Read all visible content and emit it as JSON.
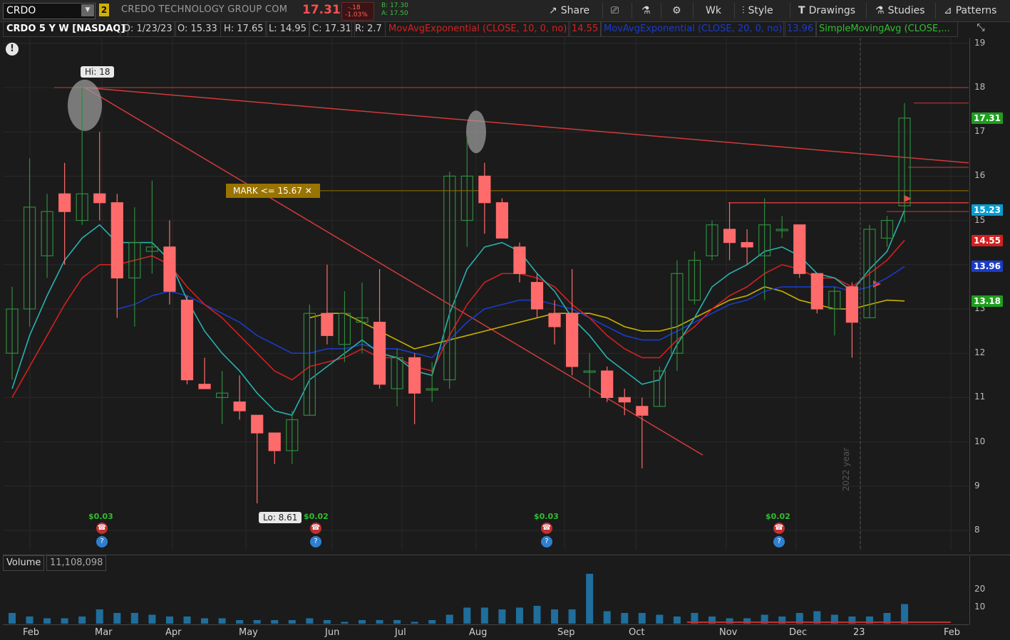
{
  "header": {
    "symbol": "CRDO",
    "link_badge": "2",
    "company": "CREDO TECHNOLOGY GROUP COM",
    "last": "17.31",
    "change": "-.18",
    "change_pct": "-1.03%",
    "bid": "B: 17.30",
    "ask": "A: 17.50"
  },
  "toolbar": {
    "share": "Share",
    "timeframe": "Wk",
    "style": "Style",
    "drawings": "Drawings",
    "studies": "Studies",
    "patterns": "Patterns"
  },
  "infobar": {
    "title": "CRDO 5 Y W [NASDAQ]",
    "date": "D: 1/23/23",
    "open": "O: 15.33",
    "high": "H: 17.65",
    "low": "L: 14.95",
    "close": "C: 17.31",
    "range": "R: 2.7",
    "ema10": "MovAvgExponential (CLOSE, 10, 0, no)",
    "ema10_val": "14.55",
    "ema20": "MovAvgExponential (CLOSE, 20, 0, no)",
    "ema20_val": "13.96",
    "sma": "SimpleMovingAvg (CLOSE,..."
  },
  "price_axis": {
    "ticks": [
      "19",
      "18",
      "17",
      "16",
      "15",
      "14",
      "13",
      "12",
      "11",
      "10",
      "9",
      "8"
    ],
    "labels": [
      {
        "text": "17.31",
        "value": 17.31,
        "color": "#1e9e1e"
      },
      {
        "text": "15.23",
        "value": 15.23,
        "color": "#0a9bd0"
      },
      {
        "text": "14.55",
        "value": 14.55,
        "color": "#d42020"
      },
      {
        "text": "13.96",
        "value": 13.96,
        "color": "#1a3cc8"
      },
      {
        "text": "13.18",
        "value": 13.18,
        "color": "#1e9e1e"
      }
    ]
  },
  "annotations": {
    "hi": "Hi: 18",
    "lo": "Lo: 8.61",
    "mark": "MARK <= 15.67",
    "mark_value": 15.67,
    "year": "2022 year",
    "dividends": [
      "$0.03",
      "$0.02",
      "$0.03",
      "$0.02"
    ]
  },
  "volume": {
    "label": "Volume",
    "value": "11,108,098",
    "ticks": [
      "20",
      "10"
    ]
  },
  "xaxis": [
    "Feb",
    "Mar",
    "Apr",
    "May",
    "Jun",
    "Jul",
    "Aug",
    "Sep",
    "Oct",
    "Nov",
    "Dec",
    "23",
    "Feb"
  ],
  "colors": {
    "up": "#2e8b3e",
    "up_fill": "#2e8b3e",
    "down": "#ff6b6b",
    "bg": "#1b1b1b",
    "ema10": "#d42020",
    "ema20": "#1a3cc8",
    "ema5": "#2ab0b0",
    "sma": "#c8b000"
  },
  "chart_data": {
    "type": "candlestick",
    "ylim": [
      7.7,
      19.3
    ],
    "candles": [
      {
        "o": 12.0,
        "h": 13.5,
        "l": 11.4,
        "c": 13.0
      },
      {
        "o": 13.0,
        "h": 16.4,
        "l": 12.6,
        "c": 15.3
      },
      {
        "o": 14.2,
        "h": 15.6,
        "l": 13.7,
        "c": 15.2
      },
      {
        "o": 15.6,
        "h": 16.3,
        "l": 14.0,
        "c": 15.2
      },
      {
        "o": 15.0,
        "h": 18.0,
        "l": 14.9,
        "c": 15.6
      },
      {
        "o": 15.6,
        "h": 17.0,
        "l": 15.0,
        "c": 15.4
      },
      {
        "o": 15.4,
        "h": 15.6,
        "l": 12.8,
        "c": 13.7
      },
      {
        "o": 13.7,
        "h": 15.3,
        "l": 12.6,
        "c": 14.5
      },
      {
        "o": 14.3,
        "h": 15.9,
        "l": 13.8,
        "c": 14.4
      },
      {
        "o": 14.4,
        "h": 15.0,
        "l": 13.1,
        "c": 13.4
      },
      {
        "o": 13.2,
        "h": 13.3,
        "l": 11.3,
        "c": 11.4
      },
      {
        "o": 11.3,
        "h": 11.9,
        "l": 11.2,
        "c": 11.2
      },
      {
        "o": 11.0,
        "h": 11.6,
        "l": 10.4,
        "c": 11.1
      },
      {
        "o": 10.9,
        "h": 11.5,
        "l": 10.5,
        "c": 10.7
      },
      {
        "o": 10.6,
        "h": 10.6,
        "l": 8.61,
        "c": 10.2
      },
      {
        "o": 10.2,
        "h": 10.2,
        "l": 9.5,
        "c": 9.8
      },
      {
        "o": 9.8,
        "h": 10.7,
        "l": 9.5,
        "c": 10.5
      },
      {
        "o": 10.6,
        "h": 13.1,
        "l": 10.6,
        "c": 12.9
      },
      {
        "o": 12.9,
        "h": 14.0,
        "l": 12.2,
        "c": 12.4
      },
      {
        "o": 12.2,
        "h": 13.4,
        "l": 11.8,
        "c": 12.9
      },
      {
        "o": 12.7,
        "h": 13.6,
        "l": 12.0,
        "c": 12.8
      },
      {
        "o": 12.7,
        "h": 13.9,
        "l": 11.2,
        "c": 11.3
      },
      {
        "o": 11.2,
        "h": 12.1,
        "l": 10.8,
        "c": 11.9
      },
      {
        "o": 11.9,
        "h": 12.0,
        "l": 10.4,
        "c": 11.1
      },
      {
        "o": 11.2,
        "h": 11.8,
        "l": 10.9,
        "c": 11.2
      },
      {
        "o": 11.4,
        "h": 16.1,
        "l": 11.2,
        "c": 16.0
      },
      {
        "o": 15.0,
        "h": 16.9,
        "l": 14.4,
        "c": 16.0
      },
      {
        "o": 16.0,
        "h": 16.3,
        "l": 14.7,
        "c": 15.4
      },
      {
        "o": 15.4,
        "h": 15.5,
        "l": 14.6,
        "c": 14.6
      },
      {
        "o": 14.4,
        "h": 14.5,
        "l": 13.6,
        "c": 13.8
      },
      {
        "o": 13.6,
        "h": 13.8,
        "l": 12.8,
        "c": 13.0
      },
      {
        "o": 12.9,
        "h": 13.2,
        "l": 12.2,
        "c": 12.6
      },
      {
        "o": 12.9,
        "h": 13.9,
        "l": 11.5,
        "c": 11.7
      },
      {
        "o": 11.6,
        "h": 12.0,
        "l": 11.0,
        "c": 11.6
      },
      {
        "o": 11.6,
        "h": 11.7,
        "l": 10.9,
        "c": 11.0
      },
      {
        "o": 11.0,
        "h": 11.2,
        "l": 10.6,
        "c": 10.9
      },
      {
        "o": 10.8,
        "h": 11.0,
        "l": 9.4,
        "c": 10.6
      },
      {
        "o": 10.8,
        "h": 11.7,
        "l": 10.8,
        "c": 11.6
      },
      {
        "o": 12.0,
        "h": 14.1,
        "l": 11.6,
        "c": 13.8
      },
      {
        "o": 13.2,
        "h": 14.3,
        "l": 13.1,
        "c": 14.1
      },
      {
        "o": 14.2,
        "h": 15.0,
        "l": 14.1,
        "c": 14.9
      },
      {
        "o": 14.8,
        "h": 15.4,
        "l": 14.1,
        "c": 14.5
      },
      {
        "o": 14.5,
        "h": 14.8,
        "l": 14.0,
        "c": 14.4
      },
      {
        "o": 14.2,
        "h": 15.5,
        "l": 13.2,
        "c": 14.9
      },
      {
        "o": 14.8,
        "h": 15.1,
        "l": 14.6,
        "c": 14.8
      },
      {
        "o": 14.9,
        "h": 14.9,
        "l": 13.7,
        "c": 13.8
      },
      {
        "o": 13.8,
        "h": 13.8,
        "l": 12.9,
        "c": 13.0
      },
      {
        "o": 13.0,
        "h": 13.5,
        "l": 12.4,
        "c": 13.4
      },
      {
        "o": 13.5,
        "h": 13.6,
        "l": 11.9,
        "c": 12.7
      },
      {
        "o": 12.8,
        "h": 14.9,
        "l": 12.8,
        "c": 14.8
      },
      {
        "o": 14.6,
        "h": 15.1,
        "l": 14.4,
        "c": 15.0
      },
      {
        "o": 15.33,
        "h": 17.65,
        "l": 14.95,
        "c": 17.31
      }
    ],
    "ema5": [
      11.2,
      12.4,
      13.3,
      14.1,
      14.6,
      14.9,
      14.5,
      14.5,
      14.5,
      14.1,
      13.2,
      12.5,
      12.0,
      11.6,
      11.1,
      10.7,
      10.6,
      11.4,
      11.7,
      12.0,
      12.3,
      12.0,
      11.9,
      11.6,
      11.5,
      12.9,
      13.9,
      14.4,
      14.5,
      14.3,
      13.8,
      13.4,
      12.8,
      12.4,
      11.9,
      11.6,
      11.3,
      11.4,
      12.2,
      12.8,
      13.5,
      13.8,
      14.0,
      14.3,
      14.4,
      14.2,
      13.8,
      13.7,
      13.4,
      13.9,
      14.3,
      15.23
    ],
    "ema10": [
      11.0,
      11.7,
      12.4,
      13.1,
      13.7,
      14.0,
      14.0,
      14.1,
      14.2,
      14.0,
      13.5,
      13.1,
      12.8,
      12.4,
      12.0,
      11.6,
      11.4,
      11.7,
      11.8,
      11.9,
      12.1,
      11.9,
      11.9,
      11.7,
      11.6,
      12.4,
      13.1,
      13.6,
      13.8,
      13.8,
      13.7,
      13.5,
      13.1,
      12.8,
      12.4,
      12.1,
      11.9,
      11.9,
      12.3,
      12.6,
      13.0,
      13.3,
      13.5,
      13.8,
      14.0,
      13.9,
      13.7,
      13.7,
      13.5,
      13.8,
      14.1,
      14.55
    ],
    "ema20": [
      null,
      null,
      null,
      null,
      null,
      null,
      13.0,
      13.1,
      13.3,
      13.4,
      13.3,
      13.1,
      12.9,
      12.7,
      12.4,
      12.2,
      12.0,
      12.0,
      12.1,
      12.1,
      12.2,
      12.1,
      12.1,
      12.0,
      11.9,
      12.3,
      12.7,
      13.0,
      13.1,
      13.2,
      13.2,
      13.1,
      13.0,
      12.8,
      12.6,
      12.4,
      12.3,
      12.3,
      12.5,
      12.7,
      12.9,
      13.1,
      13.2,
      13.4,
      13.5,
      13.5,
      13.5,
      13.5,
      13.4,
      13.5,
      13.7,
      13.96
    ],
    "sma": [
      null,
      null,
      null,
      null,
      null,
      null,
      null,
      null,
      null,
      null,
      null,
      null,
      null,
      null,
      null,
      null,
      null,
      12.8,
      12.9,
      12.9,
      12.7,
      12.5,
      12.3,
      12.1,
      12.2,
      12.3,
      12.4,
      12.5,
      12.6,
      12.7,
      12.8,
      12.9,
      12.9,
      12.9,
      12.8,
      12.6,
      12.5,
      12.5,
      12.6,
      12.8,
      13.0,
      13.2,
      13.3,
      13.5,
      13.4,
      13.2,
      13.1,
      13.0,
      13.0,
      13.1,
      13.2,
      13.18
    ],
    "volume": [
      6,
      4,
      3,
      3,
      4,
      8,
      6,
      6,
      5,
      4,
      4,
      3,
      3,
      2,
      2,
      2,
      2,
      3,
      2,
      1,
      2,
      2,
      2,
      1,
      2,
      5,
      9,
      9,
      8,
      9,
      10,
      8,
      8,
      28,
      7,
      6,
      6,
      5,
      4,
      6,
      4,
      3,
      3,
      5,
      4,
      6,
      7,
      5,
      4,
      4,
      6,
      11
    ]
  }
}
